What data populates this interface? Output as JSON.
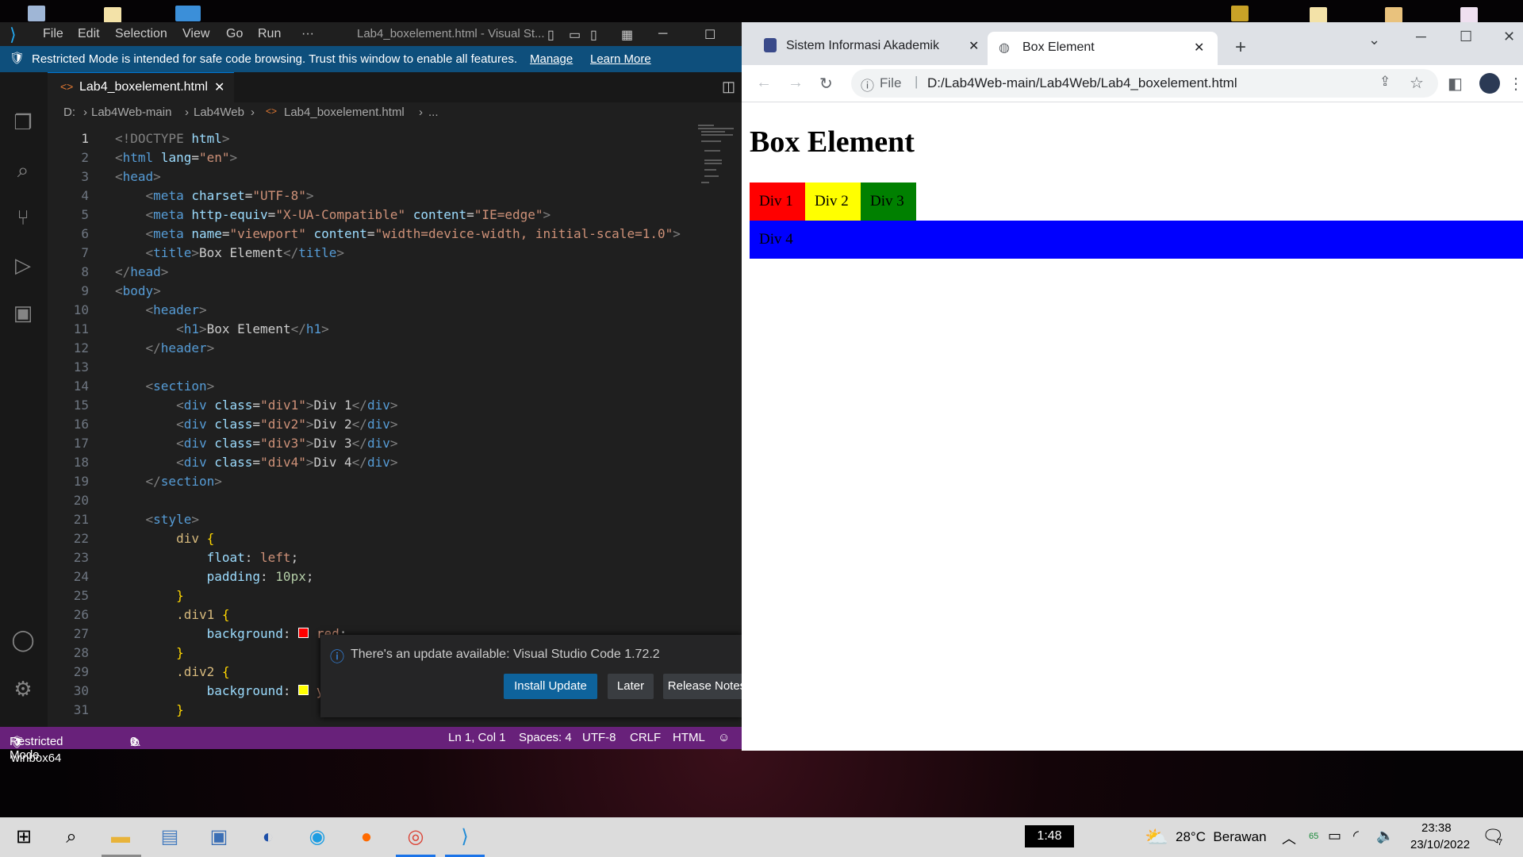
{
  "desktop": {
    "icon_label": "winbox64"
  },
  "vscode": {
    "menu": [
      "File",
      "Edit",
      "Selection",
      "View",
      "Go",
      "Run",
      "···"
    ],
    "window_title": "Lab4_boxelement.html - Visual St...",
    "banner": {
      "text": "Restricted Mode is intended for safe code browsing. Trust this window to enable all features.",
      "manage": "Manage",
      "learn_more": "Learn More"
    },
    "tab_label": "Lab4_boxelement.html",
    "breadcrumb": [
      "D:",
      "Lab4Web-main",
      "Lab4Web",
      "Lab4_boxelement.html",
      "..."
    ],
    "code_lines": [
      {
        "n": "1",
        "html": "<span class='t'>&lt;!DOCTYPE</span> <span class='at'>html</span><span class='t'>&gt;</span>"
      },
      {
        "n": "2",
        "html": "<span class='t'>&lt;</span><span class='tag'>html</span> <span class='at'>lang</span>=<span class='str'>\"en\"</span><span class='t'>&gt;</span>"
      },
      {
        "n": "3",
        "html": "<span class='t'>&lt;</span><span class='tag'>head</span><span class='t'>&gt;</span>"
      },
      {
        "n": "4",
        "html": "    <span class='t'>&lt;</span><span class='tag'>meta</span> <span class='at'>charset</span>=<span class='str'>\"UTF-8\"</span><span class='t'>&gt;</span>"
      },
      {
        "n": "5",
        "html": "    <span class='t'>&lt;</span><span class='tag'>meta</span> <span class='at'>http-equiv</span>=<span class='str'>\"X-UA-Compatible\"</span> <span class='at'>content</span>=<span class='str'>\"IE=edge\"</span><span class='t'>&gt;</span>"
      },
      {
        "n": "6",
        "html": "    <span class='t'>&lt;</span><span class='tag'>meta</span> <span class='at'>name</span>=<span class='str'>\"viewport\"</span> <span class='at'>content</span>=<span class='str'>\"width=device-width, initial-scale=1.0\"</span><span class='t'>&gt;</span>"
      },
      {
        "n": "7",
        "html": "    <span class='t'>&lt;</span><span class='tag'>title</span><span class='t'>&gt;</span>Box Element<span class='t'>&lt;/</span><span class='tag'>title</span><span class='t'>&gt;</span>"
      },
      {
        "n": "8",
        "html": "<span class='t'>&lt;/</span><span class='tag'>head</span><span class='t'>&gt;</span>"
      },
      {
        "n": "9",
        "html": "<span class='t'>&lt;</span><span class='tag'>body</span><span class='t'>&gt;</span>"
      },
      {
        "n": "10",
        "html": "    <span class='t'>&lt;</span><span class='tag'>header</span><span class='t'>&gt;</span>"
      },
      {
        "n": "11",
        "html": "        <span class='t'>&lt;</span><span class='tag'>h1</span><span class='t'>&gt;</span>Box Element<span class='t'>&lt;/</span><span class='tag'>h1</span><span class='t'>&gt;</span>"
      },
      {
        "n": "12",
        "html": "    <span class='t'>&lt;/</span><span class='tag'>header</span><span class='t'>&gt;</span>"
      },
      {
        "n": "13",
        "html": ""
      },
      {
        "n": "14",
        "html": "    <span class='t'>&lt;</span><span class='tag'>section</span><span class='t'>&gt;</span>"
      },
      {
        "n": "15",
        "html": "        <span class='t'>&lt;</span><span class='tag'>div</span> <span class='at'>class</span>=<span class='str'>\"div1\"</span><span class='t'>&gt;</span>Div 1<span class='t'>&lt;/</span><span class='tag'>div</span><span class='t'>&gt;</span>"
      },
      {
        "n": "16",
        "html": "        <span class='t'>&lt;</span><span class='tag'>div</span> <span class='at'>class</span>=<span class='str'>\"div2\"</span><span class='t'>&gt;</span>Div 2<span class='t'>&lt;/</span><span class='tag'>div</span><span class='t'>&gt;</span>"
      },
      {
        "n": "17",
        "html": "        <span class='t'>&lt;</span><span class='tag'>div</span> <span class='at'>class</span>=<span class='str'>\"div3\"</span><span class='t'>&gt;</span>Div 3<span class='t'>&lt;/</span><span class='tag'>div</span><span class='t'>&gt;</span>"
      },
      {
        "n": "18",
        "html": "        <span class='t'>&lt;</span><span class='tag'>div</span> <span class='at'>class</span>=<span class='str'>\"div4\"</span><span class='t'>&gt;</span>Div 4<span class='t'>&lt;/</span><span class='tag'>div</span><span class='t'>&gt;</span>"
      },
      {
        "n": "19",
        "html": "    <span class='t'>&lt;/</span><span class='tag'>section</span><span class='t'>&gt;</span>"
      },
      {
        "n": "20",
        "html": ""
      },
      {
        "n": "21",
        "html": "    <span class='t'>&lt;</span><span class='tag'>style</span><span class='t'>&gt;</span>"
      },
      {
        "n": "22",
        "html": "        <span class='sel'>div</span> <span class='br'>{</span>"
      },
      {
        "n": "23",
        "html": "            <span class='prop'>float</span>: <span class='val'>left</span>;"
      },
      {
        "n": "24",
        "html": "            <span class='prop'>padding</span>: <span class='num'>10px</span>;"
      },
      {
        "n": "25",
        "html": "        <span class='br'>}</span>"
      },
      {
        "n": "26",
        "html": "        <span class='sel'>.div1</span> <span class='br'>{</span>"
      },
      {
        "n": "27",
        "html": "            <span class='prop'>background</span>: <span style='display:inline-block;width:11px;height:11px;background:red;border:1px solid #fff;'></span> <span class='val'>red</span>;"
      },
      {
        "n": "28",
        "html": "        <span class='br'>}</span>"
      },
      {
        "n": "29",
        "html": "        <span class='sel'>.div2</span> <span class='br'>{</span>"
      },
      {
        "n": "30",
        "html": "            <span class='prop'>background</span>: <span style='display:inline-block;width:11px;height:11px;background:yellow;border:1px solid #fff;'></span> <span class='val'>yellow</span>;"
      },
      {
        "n": "31",
        "html": "        <span class='br'>}</span>"
      }
    ],
    "notification": {
      "message": "There's an update available: Visual Studio Code 1.72.2",
      "install": "Install Update",
      "later": "Later",
      "release_notes": "Release Notes"
    },
    "status": {
      "mode": "Restricted Mode",
      "errors": "0",
      "warnings": "0",
      "position": "Ln 1, Col 1",
      "spaces": "Spaces: 4",
      "encoding": "UTF-8",
      "eol": "CRLF",
      "language": "HTML"
    }
  },
  "chrome": {
    "tabs": [
      {
        "title": "Sistem Informasi Akademik"
      },
      {
        "title": "Box Element"
      }
    ],
    "url_prefix": "File",
    "url": "D:/Lab4Web-main/Lab4Web/Lab4_boxelement.html",
    "page": {
      "heading": "Box Element",
      "boxes": [
        {
          "label": "Div 1",
          "color": "#ff0000"
        },
        {
          "label": "Div 2",
          "color": "#ffff00"
        },
        {
          "label": "Div 3",
          "color": "#008000"
        },
        {
          "label": "Div 4",
          "color": "#0000ff"
        }
      ]
    }
  },
  "taskbar": {
    "clock_chip": "1:48",
    "weather": "28°C  Berawan",
    "battery_badge": "65",
    "time": "23:38",
    "date": "23/10/2022",
    "notification_count": "7"
  }
}
